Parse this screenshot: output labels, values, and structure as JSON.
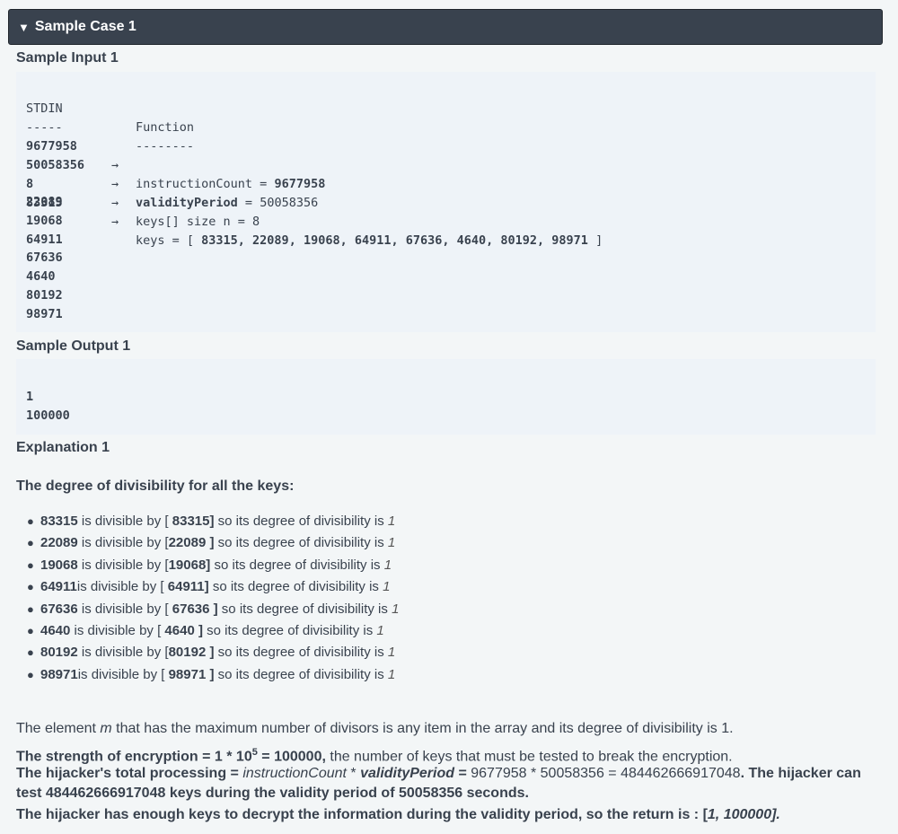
{
  "header": {
    "icon": "triangle-down-icon",
    "title": "Sample Case 1"
  },
  "input": {
    "title": "Sample Input 1",
    "col_stdin": "STDIN",
    "col_function": "Function",
    "dash_stdin": "-----",
    "dash_function": "--------",
    "arrow": "→",
    "rows": [
      {
        "stdin": "9677958",
        "prefix": "instructionCount = ",
        "value": "9677958",
        "label_bold": false
      },
      {
        "stdin": "50058356",
        "prefix": "validityPeriod",
        "mid": " = ",
        "value": "50058356",
        "label_bold": true
      },
      {
        "stdin": "8",
        "prefix": "keys[] size n = 8"
      },
      {
        "stdin": "83315",
        "prefix": "keys = [ ",
        "value": "83315, 22089, 19068, 64911, 67636, 4640, 80192, 98971",
        "suffix": " ]"
      },
      {
        "stdin": "22089"
      },
      {
        "stdin": "19068"
      },
      {
        "stdin": "64911"
      },
      {
        "stdin": "67636"
      },
      {
        "stdin": "4640"
      },
      {
        "stdin": "80192"
      },
      {
        "stdin": "98971"
      }
    ]
  },
  "output": {
    "title": "Sample Output 1",
    "lines": [
      "1",
      "100000"
    ]
  },
  "explanation": {
    "title": "Explanation 1",
    "degree_title": "The degree of divisibility for all the keys:",
    "items": [
      {
        "key": "83315",
        "t1": " is divisible by [ ",
        "div": "83315]",
        "t2": " so its degree of divisibility is ",
        "deg": "1"
      },
      {
        "key": "22089",
        "t1": " is divisible by [",
        "div": "22089 ]",
        "t2": " so its degree of divisibility is ",
        "deg": "1"
      },
      {
        "key": "19068",
        "t1": " is divisible by [",
        "div": "19068]",
        "t2": " so its degree of divisibility is ",
        "deg": "1"
      },
      {
        "key": "64911",
        "t1": "is divisible by [ ",
        "div": "64911]",
        "t2": " so its degree of divisibility is ",
        "deg": "1"
      },
      {
        "key": "67636",
        "t1": " is divisible by [ ",
        "div": "67636 ]",
        "t2": " so its degree of divisibility is ",
        "deg": "1"
      },
      {
        "key": "4640",
        "t1": " is divisible by [ ",
        "div": "4640 ]",
        "t2": " so its degree of divisibility is ",
        "deg": "1"
      },
      {
        "key": "80192",
        "t1": " is divisible by [",
        "div": "80192 ]",
        "t2": " so its degree of divisibility is ",
        "deg": "1"
      },
      {
        "key": "98971",
        "t1": "is divisible by [ ",
        "div": "98971 ]",
        "t2": " so its degree of divisibility is ",
        "deg": "1"
      }
    ],
    "p1_a": "The element ",
    "p1_m": "m",
    "p1_b": " that has the maximum number of divisors is any item in the array and its degree of divisibility is 1.",
    "p2_bold": "The strength of encryption = 1 * 10",
    "p2_sup": "5",
    "p2_bold2": " = 100000,",
    "p2_rest": " the number of keys that must be tested to break the encryption.",
    "p3_a": "The hijacker's total processing = ",
    "p3_ic": "instructionCount",
    "p3_star": " * ",
    "p3_vp": "validityPeriod",
    "p3_b": " = ",
    "p3_calc": "9677958 * 50058356 = 484462666917048",
    "p3_c": ". The hijacker can test 484462666917048 keys during the validity period of 50058356 seconds.",
    "p4_a": "The hijacker has enough keys to decrypt the information during the validity period, so the return is : [",
    "p4_ans": "1, 100000]."
  }
}
